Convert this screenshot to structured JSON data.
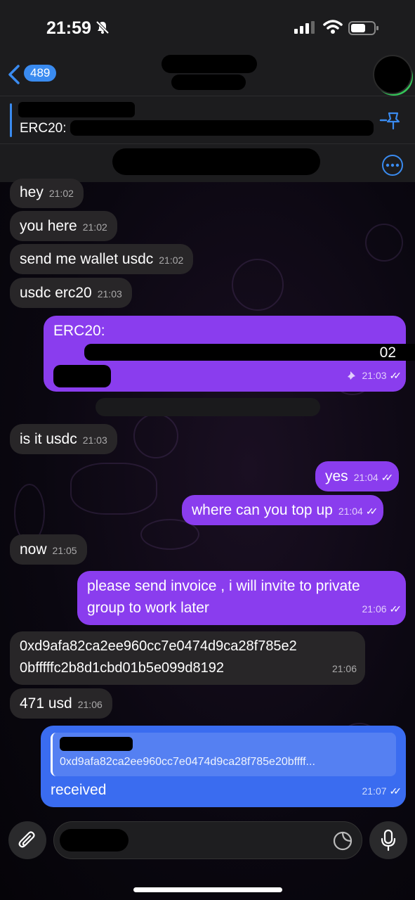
{
  "status_bar": {
    "time": "21:59"
  },
  "header": {
    "unread_count": "489"
  },
  "pinned": {
    "text": "ERC20:"
  },
  "messages": [
    {
      "text": "hey",
      "time": "21:02"
    },
    {
      "text": "you here",
      "time": "21:02"
    },
    {
      "text": "send me wallet usdc",
      "time": "21:02"
    },
    {
      "text": "usdc erc20",
      "time": "21:03"
    },
    {
      "text": "ERC20:",
      "time": "21:03",
      "partial": "02"
    },
    {
      "text": "is it usdc",
      "time": "21:03"
    },
    {
      "text": "yes",
      "time": "21:04"
    },
    {
      "text": "where can you top up",
      "time": "21:04"
    },
    {
      "text": "now",
      "time": "21:05"
    },
    {
      "line1": "please send invoice , i will invite to private",
      "line2": "group to work later",
      "time": "21:06"
    },
    {
      "line1": "0xd9afa82ca2ee960cc7e0474d9ca28f785e2",
      "line2": "0bfffffc2b8d1cbd01b5e099d8192",
      "time": "21:06"
    },
    {
      "text": "471 usd",
      "time": "21:06"
    },
    {
      "quote": "0xd9afa82ca2ee960cc7e0474d9ca28f785e20bffff...",
      "text": "received",
      "time": "21:07"
    }
  ],
  "colors": {
    "incoming": "#282628",
    "outgoing": "#8a3dee",
    "outgoing_last": "#3a6cf0",
    "accent": "#3a8bf0"
  }
}
